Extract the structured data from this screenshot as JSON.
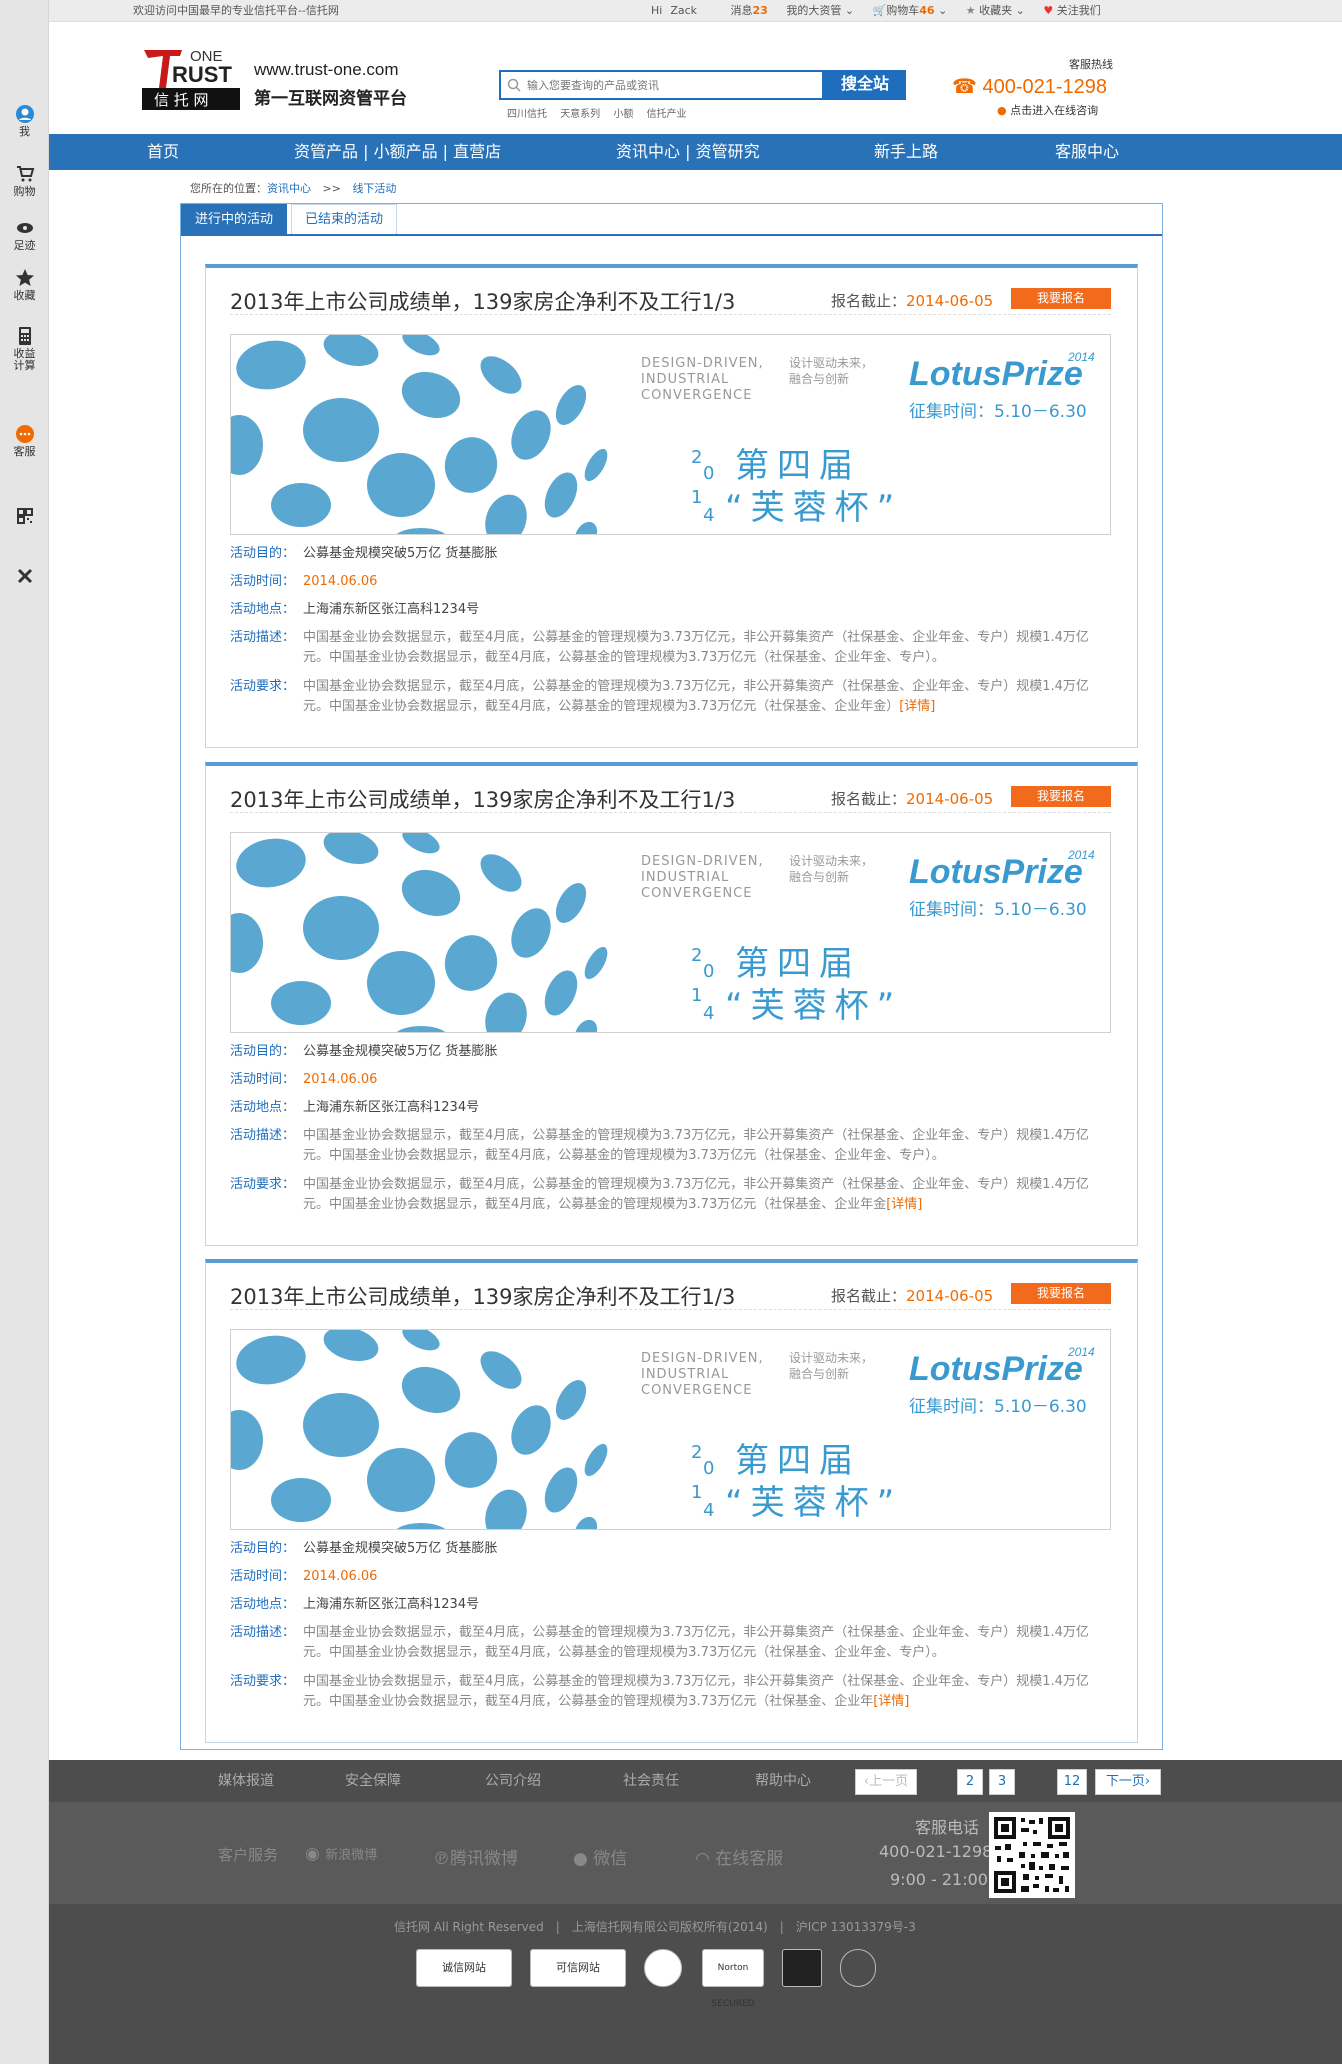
{
  "topbar": {
    "welcome": "欢迎访问中国最早的专业信托平台--信托网",
    "hi": "Hi",
    "user": "Zack",
    "messages_label": "消息",
    "messages_count": "23",
    "my_assets": "我的大资管",
    "cart_label": "购物车",
    "cart_count": "46",
    "favorites": "收藏夹",
    "follow": "关注我们"
  },
  "sidebar": {
    "items": [
      {
        "label": "我",
        "icon": "user-icon"
      },
      {
        "label": "购物",
        "icon": "cart-icon"
      },
      {
        "label": "足迹",
        "icon": "eye-icon"
      },
      {
        "label": "收藏",
        "icon": "star-icon"
      },
      {
        "label": "收益计算",
        "icon": "calculator-icon"
      },
      {
        "label": "客服",
        "icon": "chat-icon"
      },
      {
        "label": "",
        "icon": "qrcode-icon"
      },
      {
        "label": "",
        "icon": "close-icon"
      }
    ]
  },
  "header": {
    "logo_top": "ONE",
    "logo_main": "RUST",
    "logo_letter": "T",
    "logo_sub": "信 托 网",
    "site_url": "www.trust-one.com",
    "slogan": "第一互联网资管平台",
    "search_placeholder": "输入您要查询的产品或资讯",
    "search_button": "搜全站",
    "hot_links": [
      "四川信托",
      "天意系列",
      "小额",
      "信托产业"
    ],
    "hotline_label": "客服热线",
    "hotline": "400-021-1298",
    "online_help": "点击进入在线咨询"
  },
  "nav": [
    "首页",
    "资管产品 | 小额产品 | 直营店",
    "资讯中心 | 资管研究",
    "新手上路",
    "客服中心"
  ],
  "breadcrumb": {
    "label": "您所在的位置：",
    "items": [
      "资讯中心",
      ">>",
      "线下活动"
    ]
  },
  "tabs": [
    "进行中的活动",
    "已结束的活动"
  ],
  "events": [
    {
      "title": "2013年上市公司成绩单，139家房企净利不及工行1/3",
      "deadline_label": "报名截止：",
      "deadline": "2014-06-05",
      "signup": "我要报名",
      "banner": {
        "en_text": [
          "DESIGN-DRIVEN,",
          "INDUSTRIAL",
          "CONVERGENCE"
        ],
        "cn_text": [
          "设计驱动未来，",
          "融合与创新"
        ],
        "brand": "LotusPrize",
        "year": "2014",
        "period": "征集时间：5.10－6.30",
        "year_stack": [
          "2",
          "0",
          "1",
          "4"
        ],
        "headline_1": "第四届",
        "headline_2": "“芙蓉杯”"
      },
      "purpose_label": "活动目的：",
      "purpose": "公募基金规模突破5万亿 货基膨胀",
      "time_label": "活动时间：",
      "time": "2014.06.06",
      "place_label": "活动地点：",
      "place": "上海浦东新区张江高科1234号",
      "desc_label": "活动描述：",
      "desc": "中国基金业协会数据显示，截至4月底，公募基金的管理规模为3.73万亿元，非公开募集资产（社保基金、企业年金、专户）规模1.4万亿元。中国基金业协会数据显示，截至4月底，公募基金的管理规模为3.73万亿元（社保基金、企业年金、专户）。",
      "req_label": "活动要求：",
      "req": "中国基金业协会数据显示，截至4月底，公募基金的管理规模为3.73万亿元，非公开募集资产（社保基金、企业年金、专户）规模1.4万亿元。中国基金业协会数据显示，截至4月底，公募基金的管理规模为3.73万亿元（社保基金、企业年金）",
      "more": "[详情]"
    },
    {
      "title": "2013年上市公司成绩单，139家房企净利不及工行1/3",
      "deadline_label": "报名截止：",
      "deadline": "2014-06-05",
      "signup": "我要报名",
      "banner": {
        "en_text": [
          "DESIGN-DRIVEN,",
          "INDUSTRIAL",
          "CONVERGENCE"
        ],
        "cn_text": [
          "设计驱动未来，",
          "融合与创新"
        ],
        "brand": "LotusPrize",
        "year": "2014",
        "period": "征集时间：5.10－6.30",
        "year_stack": [
          "2",
          "0",
          "1",
          "4"
        ],
        "headline_1": "第四届",
        "headline_2": "“芙蓉杯”"
      },
      "purpose_label": "活动目的：",
      "purpose": "公募基金规模突破5万亿 货基膨胀",
      "time_label": "活动时间：",
      "time": "2014.06.06",
      "place_label": "活动地点：",
      "place": "上海浦东新区张江高科1234号",
      "desc_label": "活动描述：",
      "desc": "中国基金业协会数据显示，截至4月底，公募基金的管理规模为3.73万亿元，非公开募集资产（社保基金、企业年金、专户）规模1.4万亿元。中国基金业协会数据显示，截至4月底，公募基金的管理规模为3.73万亿元（社保基金、企业年金、专户）。",
      "req_label": "活动要求：",
      "req": "中国基金业协会数据显示，截至4月底，公募基金的管理规模为3.73万亿元，非公开募集资产（社保基金、企业年金、专户）规模1.4万亿元。中国基金业协会数据显示，截至4月底，公募基金的管理规模为3.73万亿元（社保基金、企业年金",
      "more": "[详情]"
    },
    {
      "title": "2013年上市公司成绩单，139家房企净利不及工行1/3",
      "deadline_label": "报名截止：",
      "deadline": "2014-06-05",
      "signup": "我要报名",
      "banner": {
        "en_text": [
          "DESIGN-DRIVEN,",
          "INDUSTRIAL",
          "CONVERGENCE"
        ],
        "cn_text": [
          "设计驱动未来，",
          "融合与创新"
        ],
        "brand": "LotusPrize",
        "year": "2014",
        "period": "征集时间：5.10－6.30",
        "year_stack": [
          "2",
          "0",
          "1",
          "4"
        ],
        "headline_1": "第四届",
        "headline_2": "“芙蓉杯”"
      },
      "purpose_label": "活动目的：",
      "purpose": "公募基金规模突破5万亿 货基膨胀",
      "time_label": "活动时间：",
      "time": "2014.06.06",
      "place_label": "活动地点：",
      "place": "上海浦东新区张江高科1234号",
      "desc_label": "活动描述：",
      "desc": "中国基金业协会数据显示，截至4月底，公募基金的管理规模为3.73万亿元，非公开募集资产（社保基金、企业年金、专户）规模1.4万亿元。中国基金业协会数据显示，截至4月底，公募基金的管理规模为3.73万亿元（社保基金、企业年金、专户）。",
      "req_label": "活动要求：",
      "req": "中国基金业协会数据显示，截至4月底，公募基金的管理规模为3.73万亿元，非公开募集资产（社保基金、企业年金、专户）规模1.4万亿元。中国基金业协会数据显示，截至4月底，公募基金的管理规模为3.73万亿元（社保基金、企业年",
      "more": "[详情]"
    }
  ],
  "footer": {
    "links": [
      "媒体报道",
      "安全保障",
      "公司介绍",
      "社会责任",
      "帮助中心"
    ],
    "pager": {
      "prev": "上一页",
      "pages": [
        "2",
        "3",
        "12"
      ],
      "next": "下一页"
    },
    "social": [
      "客户服务",
      "新浪微博",
      "腾讯微博",
      "微信",
      "在线客服"
    ],
    "cs_label": "客服电话",
    "cs_phone": "400-021-1298",
    "cs_hours": "9:00 - 21:00",
    "copyright": "信托网 All Right Reserved　|　上海信托网有限公司版权所有(2014)　|　沪ICP 13013379号-3",
    "badges": [
      "诚信网站",
      "可信网站",
      "",
      "Norton SECURED",
      "",
      ""
    ]
  }
}
